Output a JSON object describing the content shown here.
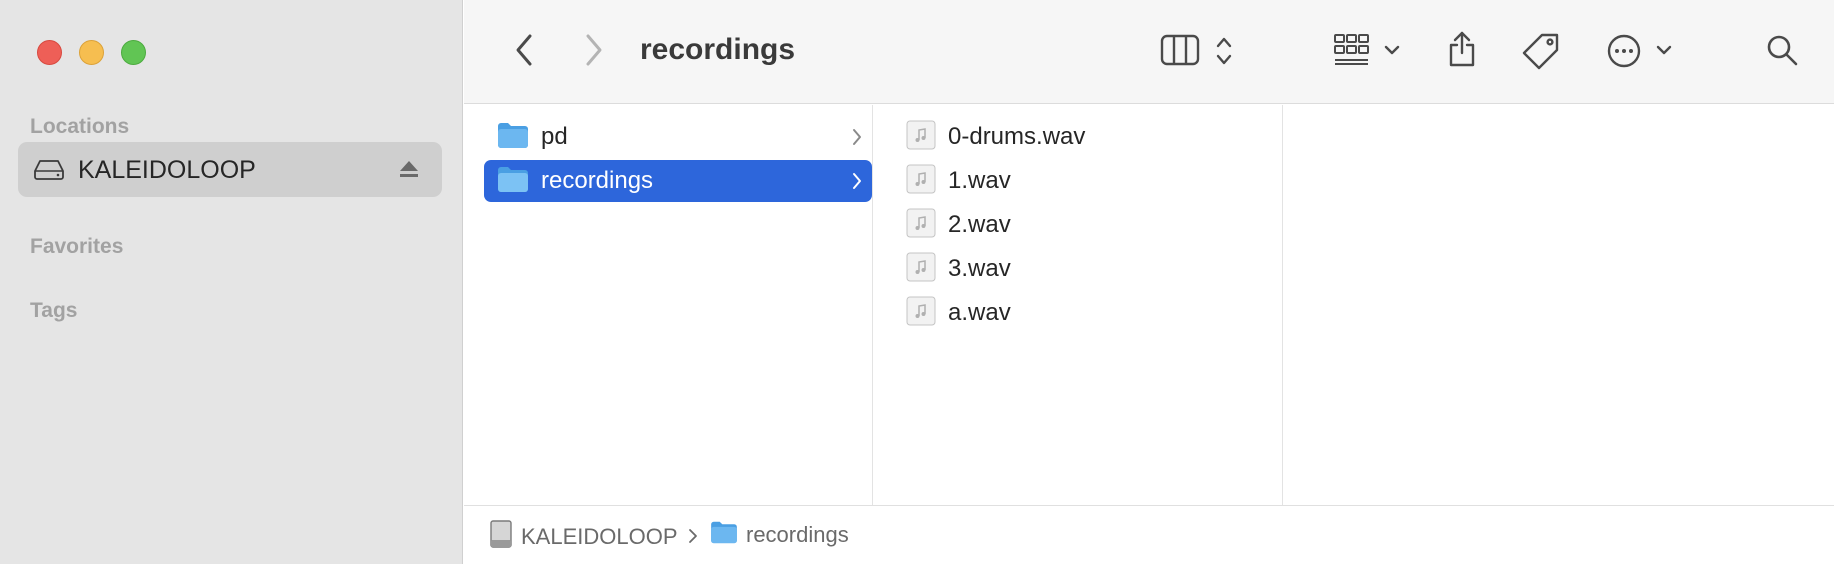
{
  "window": {
    "title": "recordings"
  },
  "sidebar": {
    "sections": {
      "locations": "Locations",
      "favorites": "Favorites",
      "tags": "Tags"
    },
    "locations": [
      {
        "label": "KALEIDOLOOP",
        "icon": "drive-icon",
        "selected": true,
        "ejectable": true
      }
    ]
  },
  "toolbar": {
    "title": "recordings",
    "icons": [
      "back-icon",
      "forward-icon",
      "column-view-icon",
      "view-toggle-icon",
      "group-icon",
      "share-icon",
      "tag-icon",
      "more-icon",
      "search-icon"
    ]
  },
  "columns": [
    {
      "items": [
        {
          "label": "pd",
          "type": "folder",
          "selected": false
        },
        {
          "label": "recordings",
          "type": "folder",
          "selected": true
        }
      ]
    },
    {
      "items": [
        {
          "label": "0-drums.wav",
          "type": "audio"
        },
        {
          "label": "1.wav",
          "type": "audio"
        },
        {
          "label": "2.wav",
          "type": "audio"
        },
        {
          "label": "3.wav",
          "type": "audio"
        },
        {
          "label": "a.wav",
          "type": "audio"
        }
      ]
    }
  ],
  "pathbar": {
    "crumbs": [
      {
        "label": "KALEIDOLOOP",
        "icon": "drive-icon"
      },
      {
        "label": "recordings",
        "icon": "folder-icon"
      }
    ]
  },
  "colors": {
    "selection": "#2d66db",
    "sidebar_bg": "#e5e5e5",
    "folder_blue": "#6cb7f0"
  }
}
